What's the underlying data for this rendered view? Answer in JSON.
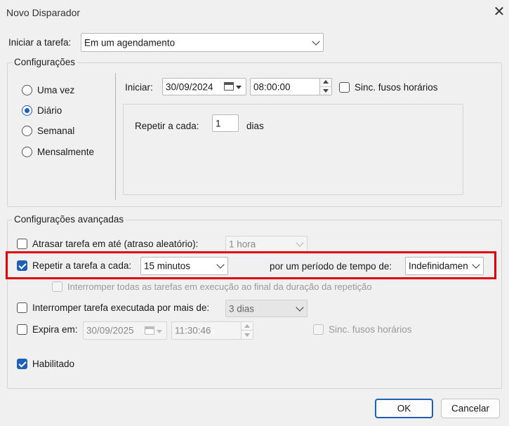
{
  "window": {
    "title": "Novo Disparador",
    "close_label": "✕"
  },
  "start_task": {
    "label": "Iniciar a tarefa:",
    "value": "Em um agendamento"
  },
  "settings": {
    "legend": "Configurações",
    "frequency": [
      {
        "label": "Uma vez",
        "selected": false
      },
      {
        "label": "Diário",
        "selected": true
      },
      {
        "label": "Semanal",
        "selected": false
      },
      {
        "label": "Mensalmente",
        "selected": false
      }
    ],
    "start_label": "Iniciar:",
    "start_date": "30/09/2024",
    "start_time": "08:00:00",
    "sync_tz_label": "Sinc. fusos horários",
    "sync_tz_checked": false,
    "recur_label": "Repetir a cada:",
    "recur_value": "1",
    "recur_unit": "dias"
  },
  "advanced": {
    "legend": "Configurações avançadas",
    "delay": {
      "label": "Atrasar tarefa em até (atraso aleatório):",
      "checked": false,
      "value": "1 hora"
    },
    "repeat": {
      "label": "Repetir a tarefa a cada:",
      "checked": true,
      "value": "15 minutos",
      "duration_label": "por um período de tempo de:",
      "duration_value": "Indefinidamente"
    },
    "stop_all": {
      "label": "Interromper todas as tarefas em execução ao final da duração da repetição",
      "checked": false
    },
    "stop_longer": {
      "label": "Interromper tarefa executada por mais de:",
      "checked": false,
      "value": "3 dias"
    },
    "expire": {
      "label": "Expira em:",
      "checked": false,
      "date": "30/09/2025",
      "time": "11:30:46",
      "sync_tz_label": "Sinc. fusos horários"
    },
    "enabled": {
      "label": "Habilitado",
      "checked": true
    }
  },
  "buttons": {
    "ok": "OK",
    "cancel": "Cancelar"
  },
  "colors": {
    "accent": "#1f5fb5",
    "highlight": "#e00000"
  }
}
